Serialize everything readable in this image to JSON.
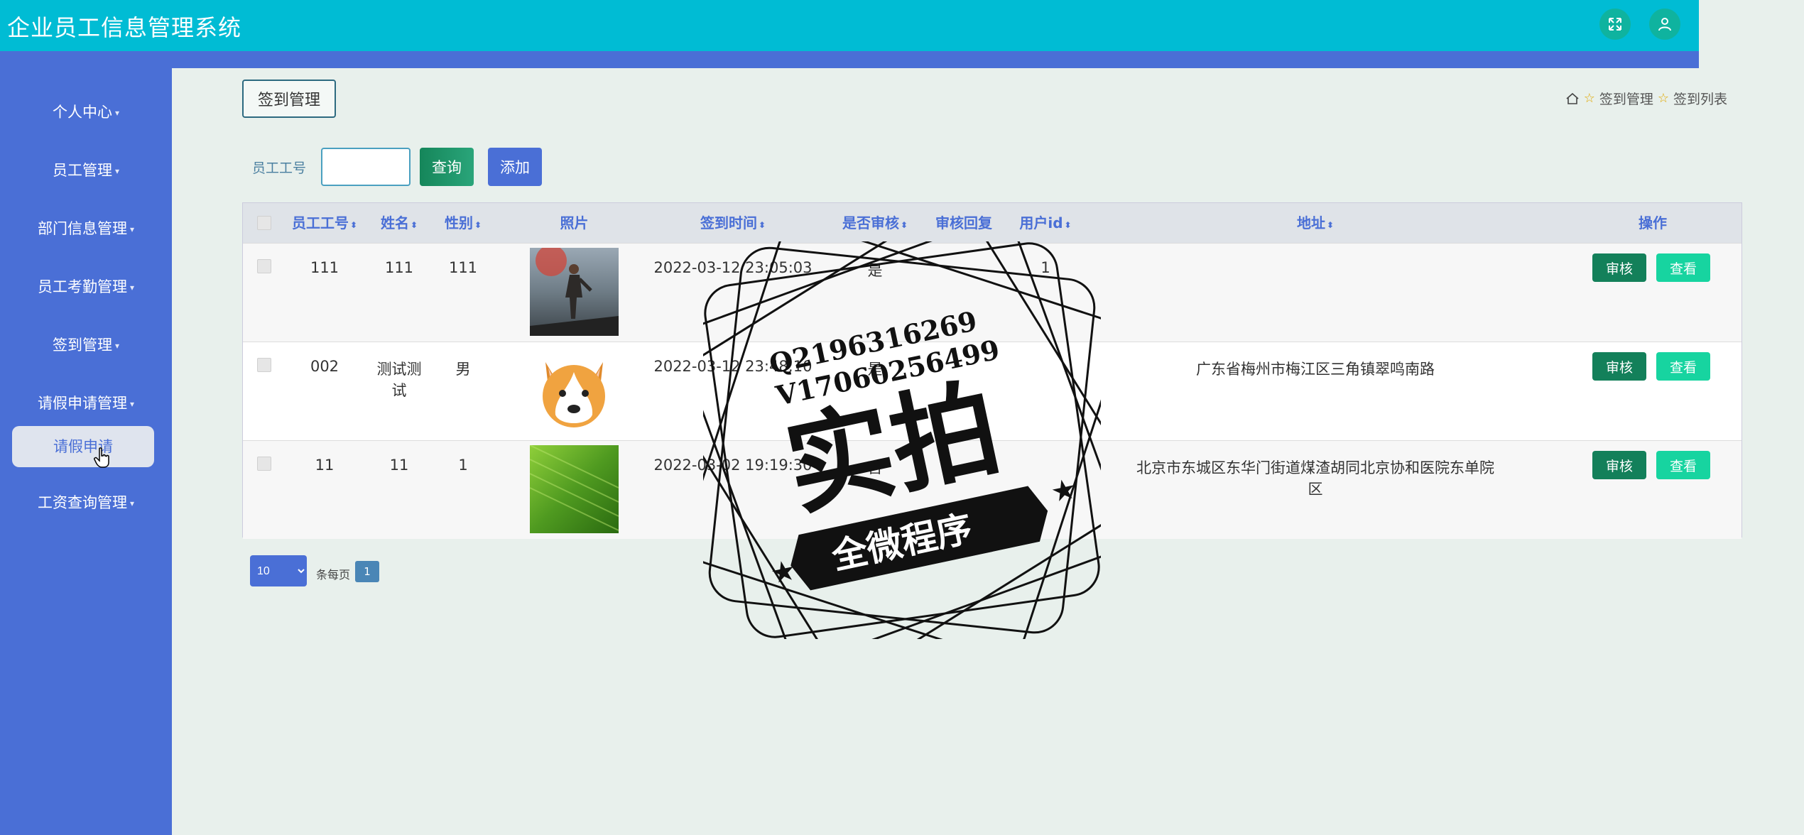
{
  "header": {
    "title": "企业员工信息管理系统"
  },
  "sidebar": {
    "items": [
      {
        "label": "个人中心"
      },
      {
        "label": "员工管理"
      },
      {
        "label": "部门信息管理"
      },
      {
        "label": "员工考勤管理"
      },
      {
        "label": "签到管理"
      },
      {
        "label": "请假申请管理"
      },
      {
        "label": "工资查询管理"
      }
    ],
    "active_sub": "请假申请"
  },
  "page": {
    "title": "签到管理",
    "breadcrumb": [
      "签到管理",
      "签到列表"
    ]
  },
  "search": {
    "label": "员工工号",
    "value": "",
    "query_label": "查询",
    "add_label": "添加"
  },
  "table": {
    "columns": [
      "员工工号",
      "姓名",
      "性别",
      "照片",
      "签到时间",
      "是否审核",
      "审核回复",
      "用户id",
      "地址",
      "操作"
    ],
    "rows": [
      {
        "id": "111",
        "name": "111",
        "gender": "111",
        "photo": "action-figure-photo",
        "time": "2022-03-12 23:05:03",
        "audited": "是",
        "reply": "",
        "user_id": "1",
        "address": "",
        "audit_label": "审核",
        "view_label": "查看"
      },
      {
        "id": "002",
        "name": "测试测试",
        "gender": "男",
        "photo": "corgi-emoji-photo",
        "time": "2022-03-12 23:48:10",
        "audited": "是",
        "reply": "",
        "user_id": "",
        "address": "广东省梅州市梅江区三角镇翠鸣南路",
        "audit_label": "审核",
        "view_label": "查看"
      },
      {
        "id": "11",
        "name": "11",
        "gender": "1",
        "photo": "green-leaf-photo",
        "time": "2022-03-02 19:19:30",
        "audited": "否",
        "reply": "",
        "user_id": "",
        "address": "北京市东城区东华门街道煤渣胡同北京协和医院东单院区",
        "audit_label": "审核",
        "view_label": "查看"
      }
    ]
  },
  "pagination": {
    "page_size": "10",
    "per_page_label": "条每页",
    "current_page": "1"
  },
  "watermark": {
    "line1": "Q2196316269",
    "line2": "V17060256499",
    "main": "实拍",
    "ribbon": "全微程序"
  },
  "colors": {
    "topbar": "#00bcd4",
    "sidebar": "#4a6fd6",
    "accent": "#4a6fd6",
    "audit_button": "#13805a",
    "view_button": "#17d4a0"
  }
}
